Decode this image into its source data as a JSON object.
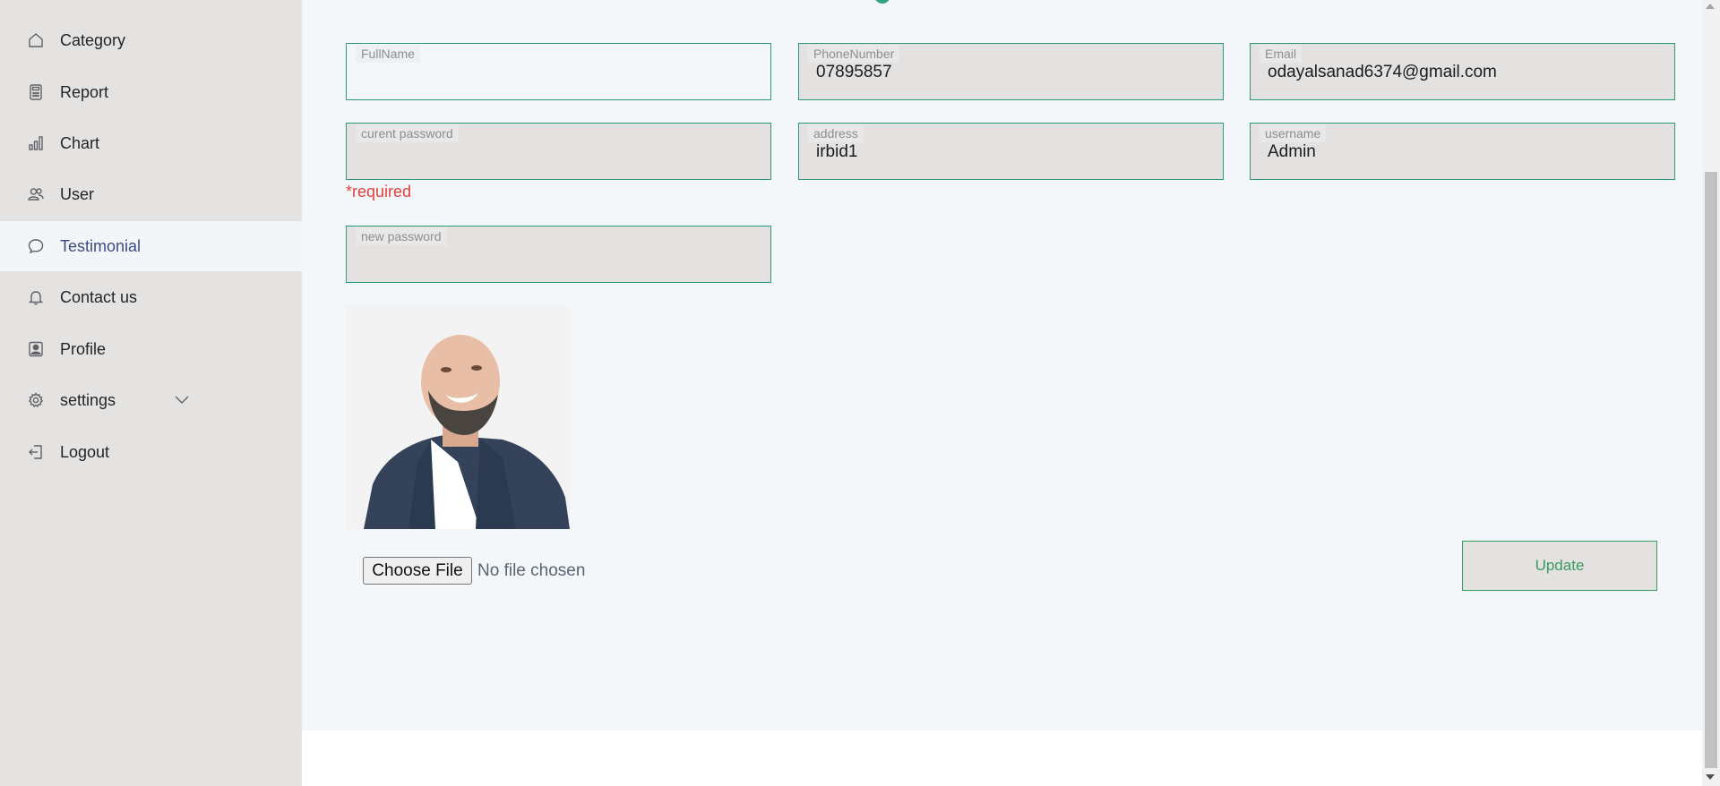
{
  "sidebar": {
    "items": [
      {
        "label": "Category",
        "icon": "home-icon"
      },
      {
        "label": "Report",
        "icon": "calculator-icon"
      },
      {
        "label": "Chart",
        "icon": "bar-chart-icon"
      },
      {
        "label": "User",
        "icon": "users-icon"
      },
      {
        "label": "Testimonial",
        "icon": "chat-bubble-icon",
        "active": true
      },
      {
        "label": "Contact us",
        "icon": "bell-icon"
      },
      {
        "label": "Profile",
        "icon": "profile-card-icon"
      },
      {
        "label": "settings",
        "icon": "gear-icon",
        "expandable": true
      },
      {
        "label": "Logout",
        "icon": "logout-icon"
      }
    ]
  },
  "form": {
    "fullname": {
      "label": "FullName",
      "value": ""
    },
    "phone": {
      "label": "PhoneNumber",
      "value": "07895857"
    },
    "email": {
      "label": "Email",
      "value": "odayalsanad6374@gmail.com"
    },
    "current_password": {
      "label": "curent password",
      "value": ""
    },
    "address": {
      "label": "address",
      "value": "irbid1"
    },
    "username": {
      "label": "username",
      "value": "Admin"
    },
    "required_msg": "*required",
    "new_password": {
      "label": "new password",
      "value": ""
    },
    "file": {
      "button_label": "Choose File",
      "status": "No file chosen"
    },
    "update_label": "Update"
  },
  "colors": {
    "accent": "#2c9a79",
    "error": "#e0413b",
    "sidebar_bg": "#e5e3e2",
    "active_nav": "#3b4a86"
  }
}
